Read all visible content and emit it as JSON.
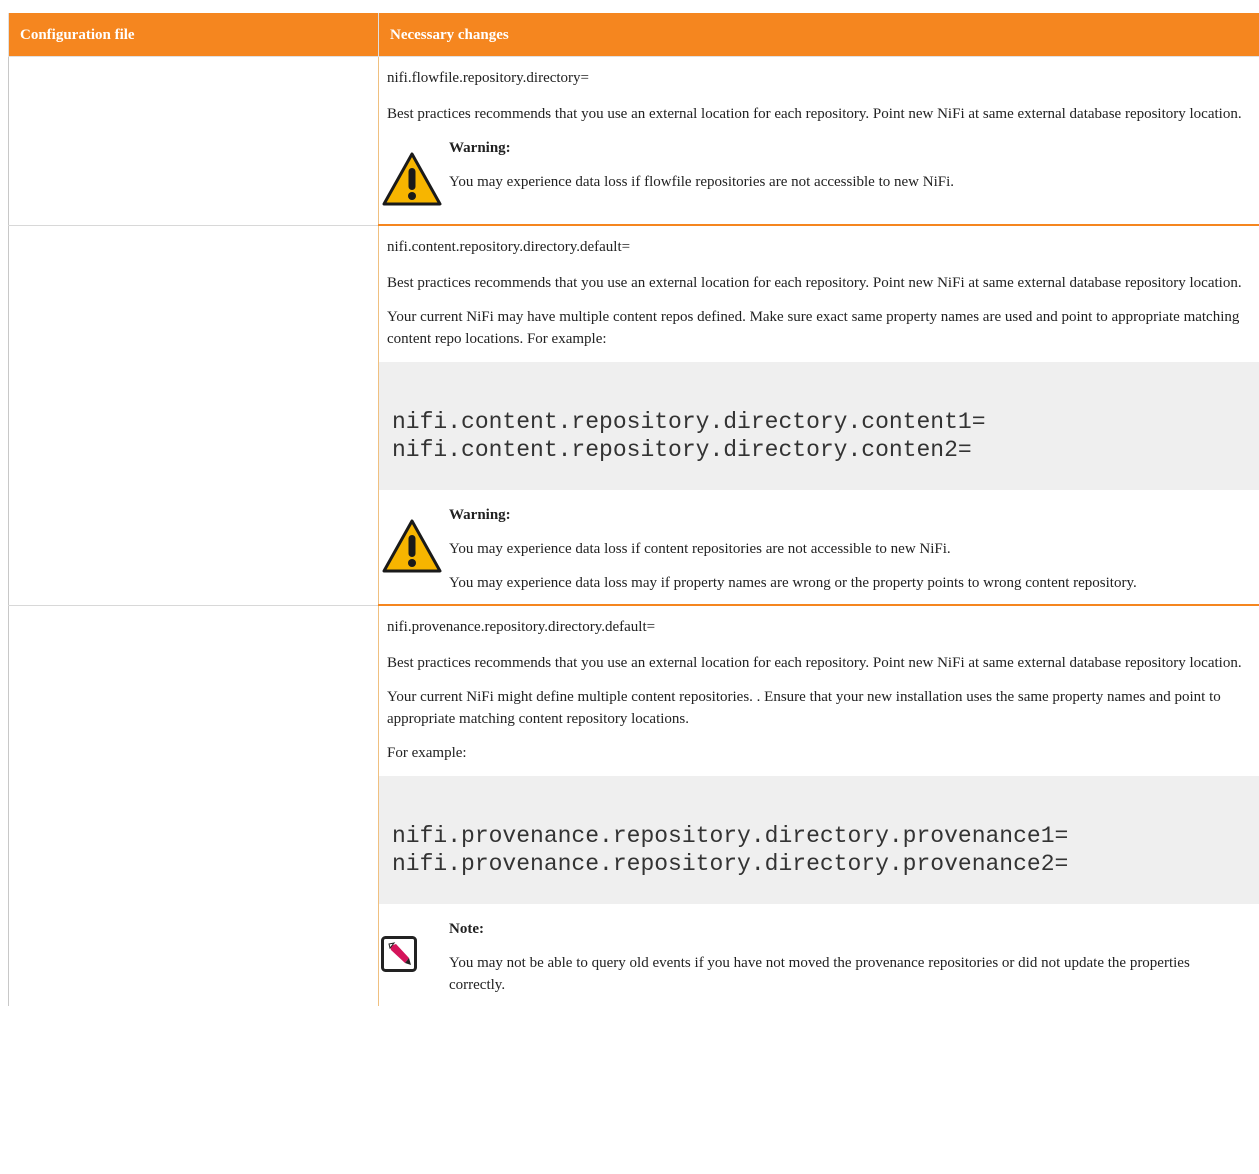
{
  "table": {
    "headers": {
      "config_file": "Configuration file",
      "changes": "Necessary changes"
    },
    "rows": [
      {
        "property": "nifi.flowfile.repository.directory=",
        "best_practice": "Best practices recommends that you use an external location for each repository. Point new NiFi at same external database repository location.",
        "callout": {
          "type": "warning",
          "icon": "warning-triangle-icon",
          "label": "Warning:",
          "lines": [
            "You may experience data loss if flowfile repositories are not accessible to new NiFi."
          ]
        }
      },
      {
        "property": "nifi.content.repository.directory.default=",
        "best_practice": "Best practices recommends that you use an external location for each repository. Point new NiFi at same external database repository location.",
        "extra": "Your current NiFi may have multiple content repos defined. Make sure exact same property names are used and point to appropriate matching content repo locations. For example:",
        "code": "nifi.content.repository.directory.content1=\nnifi.content.repository.directory.conten2=",
        "callout": {
          "type": "warning",
          "icon": "warning-triangle-icon",
          "label": "Warning:",
          "lines": [
            "You may experience data loss if content repositories are not accessible to new NiFi.",
            "You may experience data loss may if property names are wrong or the property points to wrong content repository."
          ]
        }
      },
      {
        "property": "nifi.provenance.repository.directory.default=",
        "best_practice": "Best practices recommends that you use an external location for each repository. Point new NiFi at same external database repository location.",
        "extra": "Your current NiFi might define multiple content repositories. . Ensure that your new installation uses the same property names and point to appropriate matching content repository locations.",
        "example_label": "For example:",
        "code": "nifi.provenance.repository.directory.provenance1=\nnifi.provenance.repository.directory.provenance2=",
        "callout": {
          "type": "note",
          "icon": "note-pencil-icon",
          "label": "Note:",
          "lines": [
            "You may not be able to query old events if you have not moved the provenance repositories or did not update the properties correctly."
          ]
        }
      }
    ]
  },
  "colors": {
    "header_bg": "#f5861f",
    "header_text": "#ffffff",
    "warning_yellow": "#f7b500",
    "code_bg": "#efefef"
  }
}
